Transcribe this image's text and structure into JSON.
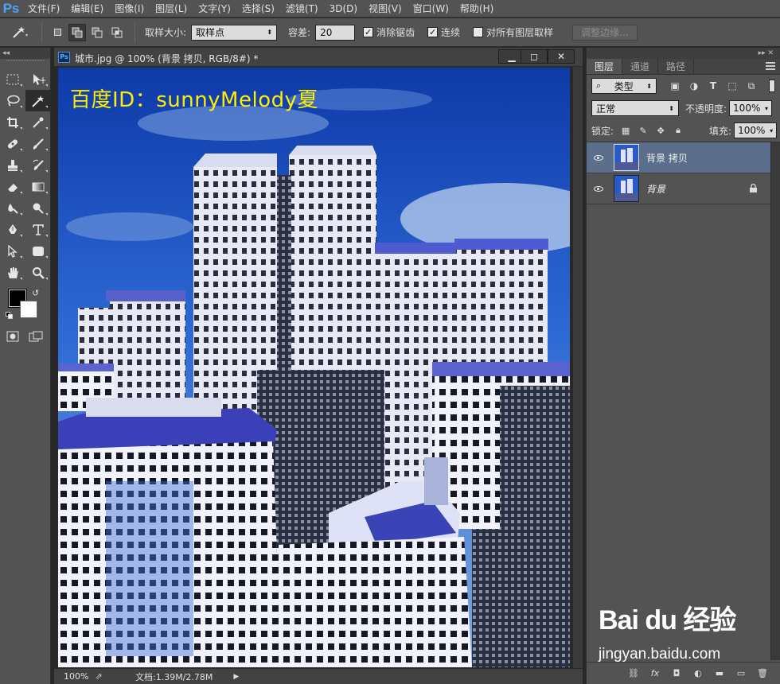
{
  "app": {
    "logo": "Ps"
  },
  "menu": [
    "文件(F)",
    "编辑(E)",
    "图像(I)",
    "图层(L)",
    "文字(Y)",
    "选择(S)",
    "滤镜(T)",
    "3D(D)",
    "视图(V)",
    "窗口(W)",
    "帮助(H)"
  ],
  "options": {
    "sample_size_label": "取样大小:",
    "sample_size_value": "取样点",
    "tolerance_label": "容差:",
    "tolerance_value": "20",
    "antialias_label": "消除锯齿",
    "antialias_checked": true,
    "contiguous_label": "连续",
    "contiguous_checked": true,
    "sample_all_label": "对所有图层取样",
    "sample_all_checked": false,
    "refine_edge_label": "调整边缘..."
  },
  "toolbar": {
    "active_tool": "magic-wand",
    "tools": [
      "rect-marquee",
      "move",
      "lasso",
      "magic-wand",
      "crop",
      "eyedropper",
      "spot-healing",
      "brush",
      "clone-stamp",
      "history-brush",
      "eraser",
      "gradient",
      "blur",
      "dodge",
      "pen",
      "type",
      "path-selection",
      "shape",
      "hand",
      "zoom"
    ],
    "foreground_color": "#000000",
    "background_color": "#ffffff"
  },
  "document": {
    "title": "城市.jpg @ 100% (背景 拷贝, RGB/8#) *",
    "watermark_text": "百度ID：sunnyMelody夏",
    "zoom": "100%",
    "doc_size": "文档:1.39M/2.78M"
  },
  "layers_panel": {
    "tabs": [
      "图层",
      "通道",
      "路径"
    ],
    "active_tab": "图层",
    "filter_label": "类型",
    "blend_mode": "正常",
    "opacity_label": "不透明度:",
    "opacity_value": "100%",
    "lock_label": "锁定:",
    "fill_label": "填充:",
    "fill_value": "100%",
    "layers": [
      {
        "name": "背景 拷贝",
        "selected": true,
        "visible": true,
        "locked": false
      },
      {
        "name": "背景",
        "selected": false,
        "visible": true,
        "locked": true
      }
    ]
  },
  "watermark": {
    "logo": "Bai du 经验",
    "url": "jingyan.baidu.com"
  },
  "colors": {
    "panel": "#535353",
    "selected_layer": "#5b6f8c",
    "sky": "#1c48b8",
    "text_yellow": "#ffee00"
  }
}
